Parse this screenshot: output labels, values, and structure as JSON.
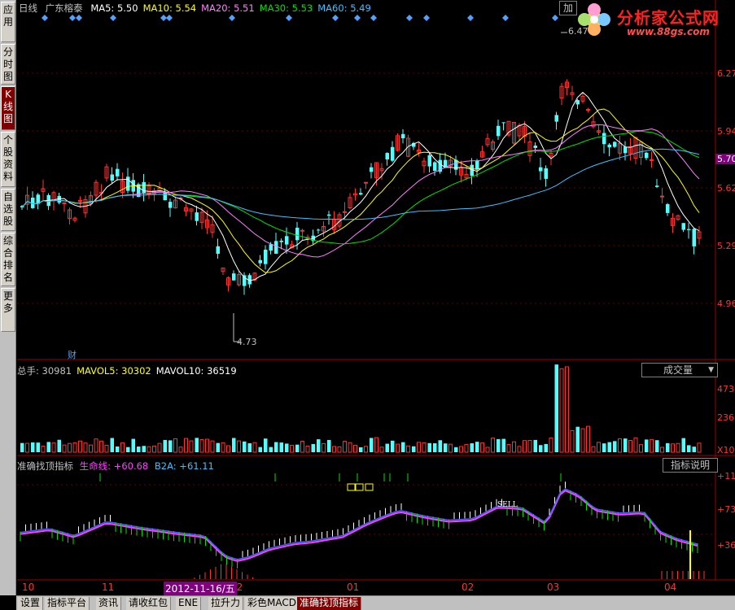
{
  "sidebar": {
    "items": [
      {
        "label": "应用",
        "active": false
      },
      {
        "label": "分时图",
        "active": false
      },
      {
        "label": "K线图",
        "active": true
      },
      {
        "label": "个股资料",
        "active": false
      },
      {
        "label": "自选股",
        "active": false
      },
      {
        "label": "综合排名",
        "active": false
      },
      {
        "label": "更多",
        "active": false
      }
    ]
  },
  "main_chart": {
    "period": "日线",
    "stock_name": "广东榕泰",
    "add_label": "加",
    "ma": [
      {
        "label": "MA5: 5.50",
        "color": "#ffffff"
      },
      {
        "label": "MA10: 5.54",
        "color": "#ffff00"
      },
      {
        "label": "MA20: 5.51",
        "color": "#ff80ff"
      },
      {
        "label": "MA30: 5.53",
        "color": "#00e000"
      },
      {
        "label": "MA60: 5.49",
        "color": "#40c0ff"
      }
    ],
    "high_label": "6.47",
    "low_label": "4.73",
    "fin_marker": "财",
    "price_ticks": [
      "6.27",
      "5.94",
      "5.62",
      "5.29",
      "4.96"
    ],
    "current_price": "5.70"
  },
  "volume": {
    "header": [
      {
        "label": "总手: 30981",
        "color": "#c0c0c0"
      },
      {
        "label": "MAVOL5: 30302",
        "color": "#ffff00"
      },
      {
        "label": "MAVOL10: 36519",
        "color": "#ffffff"
      }
    ],
    "selector": "成交量",
    "ticks": [
      "473",
      "236",
      "X10"
    ]
  },
  "indicator": {
    "name": "准确找顶指标",
    "line_label": "生命线: +60.68",
    "b2a_label": "B2A: +61.11",
    "help_button": "指标说明",
    "sell_label": "SELL",
    "ticks": [
      "+11",
      "+73",
      "+36"
    ]
  },
  "date_axis": {
    "labels": [
      "10",
      "11",
      "12",
      "01",
      "02",
      "03",
      "04"
    ],
    "cursor_date": "2012-11-16/五"
  },
  "bottom_tabs": [
    "设置",
    "指标平台",
    "资讯",
    "请收红包",
    "ENE",
    "拉升力",
    "彩色MACD",
    "准确找顶指标"
  ],
  "active_tab_index": 7,
  "logo": {
    "brand": "分析家公式网",
    "url": "www.88gs.com"
  },
  "colors": {
    "up": "#ff3232",
    "down": "#54fcfc",
    "axis": "#a00000",
    "ma5": "#ffffff",
    "ma10": "#ffff00",
    "ma20": "#ff80ff",
    "ma30": "#00e000",
    "ma60": "#40c0ff"
  }
}
